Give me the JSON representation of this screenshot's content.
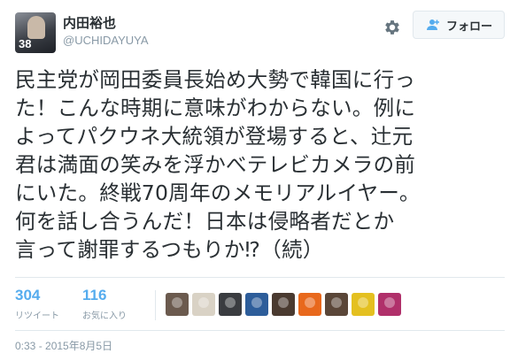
{
  "user": {
    "display_name": "内田裕也",
    "handle": "@UCHIDAYUYA",
    "avatar_number": "38"
  },
  "follow_button": {
    "label": "フォロー"
  },
  "tweet": {
    "text": "民主党が岡田委員長始め大勢で韓国に行っ\nた！こんな時期に意味がわからない。例に\nよってパクウネ大統領が登場すると、辻元\n君は満面の笑みを浮かべテレビカメラの前\nにいた。終戦70周年のメモリアルイヤー。\n何を話し合うんだ！日本は侵略者だとか\n言って謝罪するつもりか⁉︎（続）"
  },
  "stats": {
    "retweets": {
      "count": "304",
      "label": "リツイート"
    },
    "favorites": {
      "count": "116",
      "label": "お気に入り"
    }
  },
  "liked_by_avatars": [
    {
      "icon": "user-avatar-1",
      "color": "#6b5a4e"
    },
    {
      "icon": "user-avatar-2",
      "color": "#d9d2c5"
    },
    {
      "icon": "user-avatar-3",
      "color": "#3a3c40"
    },
    {
      "icon": "user-avatar-4",
      "color": "#2d5d9a"
    },
    {
      "icon": "user-avatar-5",
      "color": "#4a3a30"
    },
    {
      "icon": "user-avatar-6",
      "color": "#e8681c"
    },
    {
      "icon": "user-avatar-7",
      "color": "#5a4638"
    },
    {
      "icon": "user-avatar-8",
      "color": "#e4c020"
    },
    {
      "icon": "user-avatar-9",
      "color": "#b0306a"
    }
  ],
  "timestamp": "0:33 - 2015年8月5日",
  "colors": {
    "link_blue": "#55acee",
    "muted_gray": "#8899a6",
    "text_dark": "#292f33",
    "border": "#e1e8ed"
  }
}
